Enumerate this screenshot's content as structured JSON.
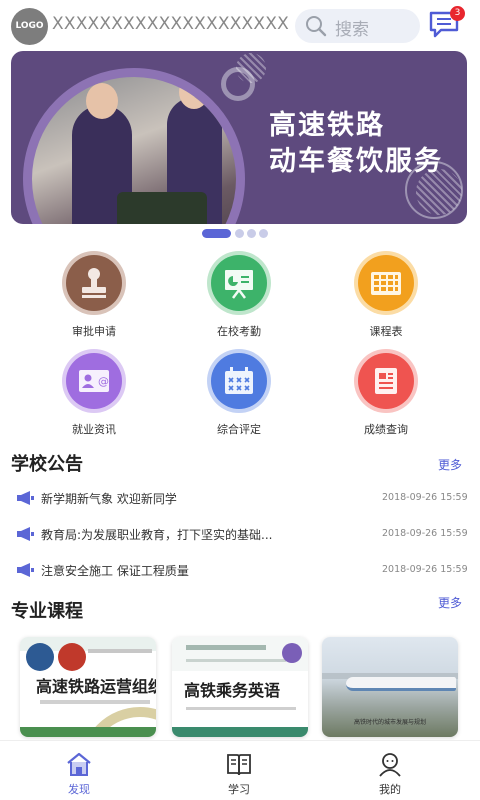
{
  "header": {
    "logo_text": "LOGO",
    "site_name": "XXXXXXXXXXXXXXXXXXXX",
    "search_placeholder": "搜索",
    "message_count": "3"
  },
  "banner": {
    "title_line1": "高速铁路",
    "title_line2": "动车餐饮服务",
    "slide_count": 4,
    "active_slide": 1
  },
  "quick_links": [
    {
      "label": "审批申请",
      "icon": "stamp-icon",
      "color": "#8b5e4a",
      "ring": "#d9c3b9"
    },
    {
      "label": "在校考勤",
      "icon": "presentation-icon",
      "color": "#3db36a",
      "ring": "#bfe6cc"
    },
    {
      "label": "课程表",
      "icon": "timetable-icon",
      "color": "#f2a01e",
      "ring": "#fbdca5"
    },
    {
      "label": "就业资讯",
      "icon": "contact-card-icon",
      "color": "#9f6de0",
      "ring": "#dcc9f4"
    },
    {
      "label": "综合评定",
      "icon": "calendar-icon",
      "color": "#4f7be0",
      "ring": "#c3d2f5"
    },
    {
      "label": "成绩查询",
      "icon": "report-icon",
      "color": "#ef5450",
      "ring": "#f9c4c2"
    }
  ],
  "announcements": {
    "title": "学校公告",
    "more_label": "更多",
    "items": [
      {
        "text": "新学期新气象 欢迎新同学",
        "time": "2018-09-26 15:59"
      },
      {
        "text": "教育局:为发展职业教育，打下坚实的基础...",
        "time": "2018-09-26 15:59"
      },
      {
        "text": "注意安全施工  保证工程质量",
        "time": "2018-09-26 15:59"
      }
    ]
  },
  "courses": {
    "title": "专业课程",
    "more_label": "更多",
    "items": [
      {
        "title": "高速铁路运营组织"
      },
      {
        "title": "高铁乘务英语"
      },
      {
        "title": "高铁时代的城市发展与规划"
      }
    ]
  },
  "tabbar": {
    "items": [
      {
        "label": "发现",
        "icon": "home-icon",
        "active": true
      },
      {
        "label": "学习",
        "icon": "book-icon",
        "active": false
      },
      {
        "label": "我的",
        "icon": "profile-icon",
        "active": false
      }
    ]
  },
  "colors": {
    "accent": "#5b66d6",
    "banner_bg": "#5e4a7e"
  }
}
